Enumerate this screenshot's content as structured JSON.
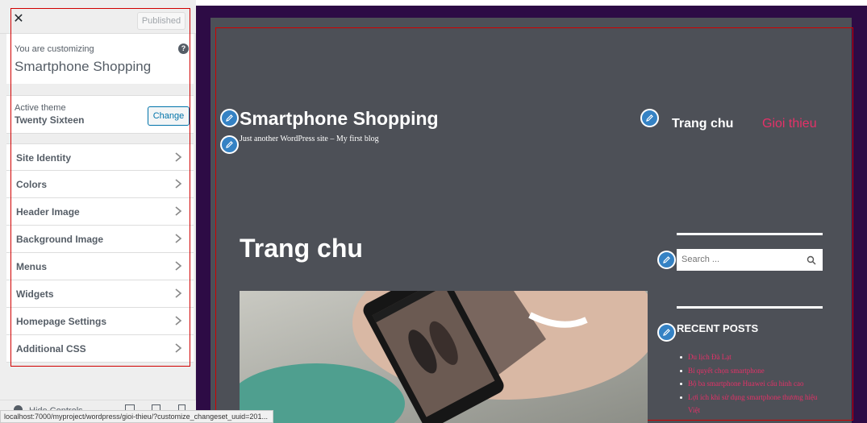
{
  "sidebar": {
    "close_symbol": "✕",
    "published_label": "Published",
    "customizing_label": "You are customizing",
    "site_name": "Smartphone Shopping",
    "help_symbol": "?",
    "active_theme_label": "Active theme",
    "theme_name": "Twenty Sixteen",
    "change_label": "Change",
    "sections": [
      {
        "label": "Site Identity"
      },
      {
        "label": "Colors"
      },
      {
        "label": "Header Image"
      },
      {
        "label": "Background Image"
      },
      {
        "label": "Menus"
      },
      {
        "label": "Widgets"
      },
      {
        "label": "Homepage Settings"
      },
      {
        "label": "Additional CSS"
      }
    ],
    "hide_controls_label": "Hide Controls"
  },
  "status_url": "localhost:7000/myproject/wordpress/gioi-thieu/?customize_changeset_uuid=201...",
  "preview": {
    "site_title": "Smartphone Shopping",
    "site_description": "Just another WordPress site – My first blog",
    "nav": {
      "home": "Trang chu",
      "about": "Gioi thieu"
    },
    "page_title": "Trang chu",
    "search_placeholder": "Search ...",
    "recent_posts_title": "RECENT POSTS",
    "recent_posts": [
      "Du lịch Đà Lạt",
      "Bí quyết chọn smartphone",
      "Bộ ba smartphone Huawei cấu hình cao",
      "Lợi ích khi sử dụng smartphone thương hiệu Việt"
    ]
  },
  "colors": {
    "accent_blue": "#0073aa",
    "edit_badge": "#3582c4",
    "preview_background": "#4d5057",
    "outer_frame": "#2d0b45",
    "link_pink": "#e53168",
    "highlight_box": "#d00000"
  }
}
